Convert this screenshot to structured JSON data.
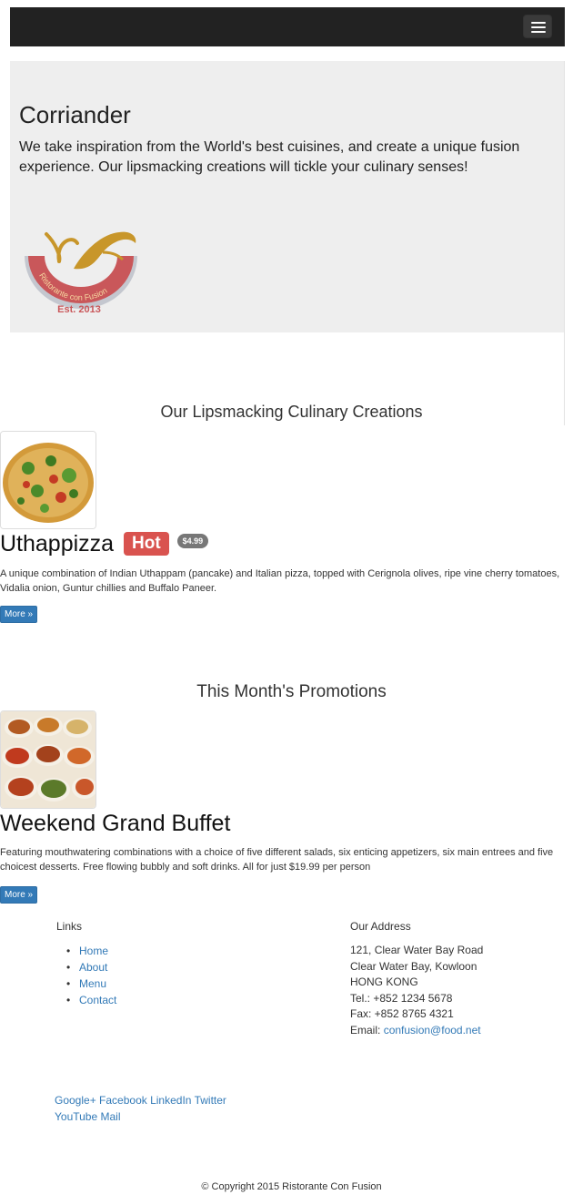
{
  "jumbotron": {
    "title": "Corriander",
    "lead": "We take inspiration from the World's best cuisines, and create a unique fusion experience. Our lipsmacking creations will tickle your culinary senses!",
    "logo_text": "Ristorante con Fusion",
    "logo_est": "Est. 2013"
  },
  "dishes": {
    "section_title": "Our Lipsmacking Culinary Creations",
    "name": "Uthappizza",
    "badge": "Hot",
    "price": "$4.99",
    "description": "A unique combination of Indian Uthappam (pancake) and Italian pizza, topped with Cerignola olives, ripe vine cherry tomatoes, Vidalia onion, Guntur chillies and Buffalo Paneer.",
    "more_label": "More »"
  },
  "promotions": {
    "section_title": "This Month's Promotions",
    "name": "Weekend Grand Buffet",
    "description": "Featuring mouthwatering combinations with a choice of five different salads, six enticing appetizers, six main entrees and five choicest desserts. Free flowing bubbly and soft drinks. All for just $19.99 per person",
    "more_label": "More »"
  },
  "footer": {
    "links_heading": "Links",
    "links": [
      "Home",
      "About",
      "Menu",
      "Contact"
    ],
    "address_heading": "Our Address",
    "address": [
      "121, Clear Water Bay Road",
      "Clear Water Bay, Kowloon",
      "HONG KONG",
      "Tel.: +852 1234 5678",
      "Fax: +852 8765 4321"
    ],
    "email_label": "Email: ",
    "email": "confusion@food.net",
    "social": [
      "Google+",
      "Facebook",
      "LinkedIn",
      "Twitter",
      "YouTube",
      "Mail"
    ],
    "copyright": "© Copyright 2015 Ristorante Con Fusion"
  },
  "colors": {
    "navbar": "#222222",
    "jumbotron": "#eeeeee",
    "hot_badge": "#d9534f",
    "price_badge": "#777777",
    "primary": "#337ab7"
  }
}
